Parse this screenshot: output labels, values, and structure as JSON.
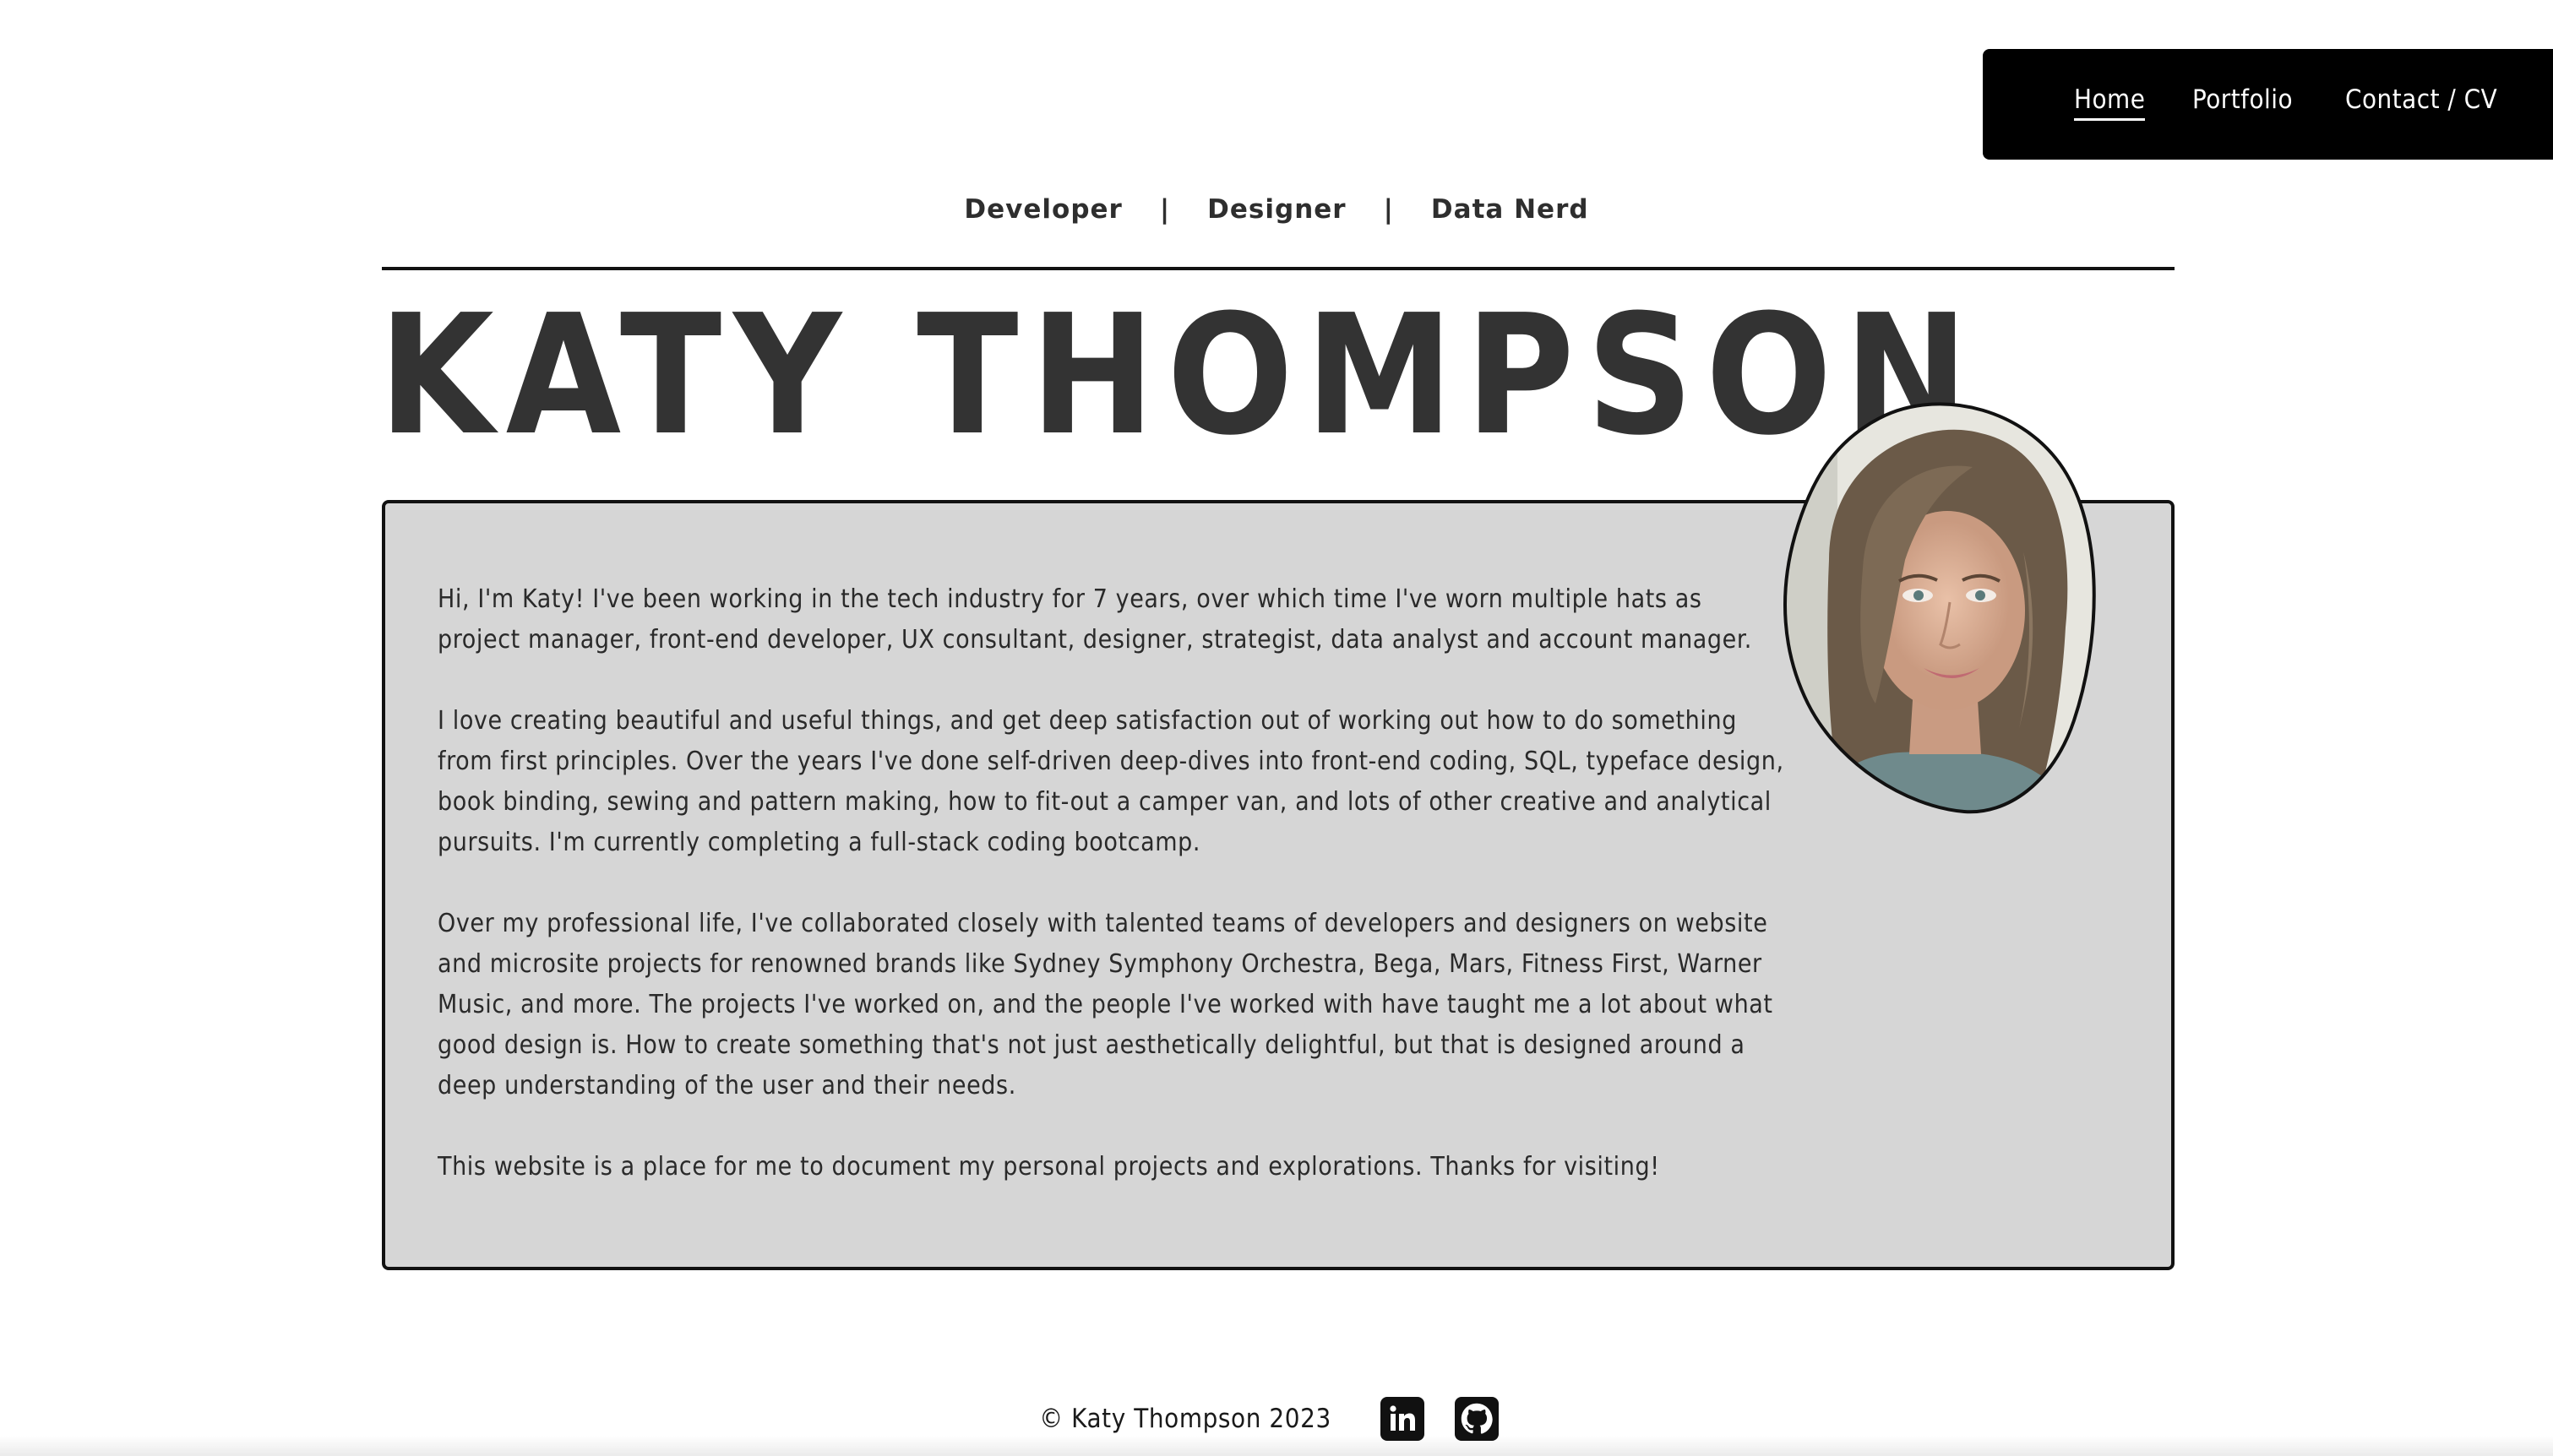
{
  "nav": {
    "items": [
      {
        "label": "Home",
        "active": true
      },
      {
        "label": "Portfolio",
        "active": false
      },
      {
        "label": "Contact / CV",
        "active": false
      }
    ]
  },
  "roles": {
    "items": [
      "Developer",
      "Designer",
      "Data Nerd"
    ],
    "separator": "|"
  },
  "hero": {
    "name": "KATY THOMPSON"
  },
  "about": {
    "paragraphs": [
      "Hi, I'm Katy! I've been working in the tech industry for 7 years, over which time I've worn multiple hats as project manager, front-end developer, UX consultant, designer, strategist, data analyst and account manager.",
      "I love creating beautiful and useful things, and get deep satisfaction out of working out how to do something from first principles. Over the years I've done self-driven deep-dives into front-end coding, SQL, typeface design, book binding, sewing and pattern making, how to fit-out a camper van, and lots of other creative and analytical pursuits. I'm currently completing a full-stack coding bootcamp.",
      "Over my professional life, I've collaborated closely with talented teams of developers and designers on website and microsite projects for renowned brands like Sydney Symphony Orchestra, Bega, Mars, Fitness First, Warner Music, and more. The projects I've worked on, and the people I've worked with have taught me a lot about what good design is. How to create something that's not just aesthetically delightful, but that is designed around a deep understanding of the user and their needs.",
      "This website is a place for me to document my personal projects and explorations. Thanks for visiting!"
    ],
    "portrait_icon": "portrait-photo"
  },
  "footer": {
    "copyright": "© Katy Thompson 2023",
    "social": [
      {
        "icon": "linkedin-icon",
        "label": "in"
      },
      {
        "icon": "github-icon"
      }
    ]
  },
  "colors": {
    "nav_bg": "#000000",
    "card_bg": "#d6d6d6",
    "text": "#2e2e2e"
  }
}
